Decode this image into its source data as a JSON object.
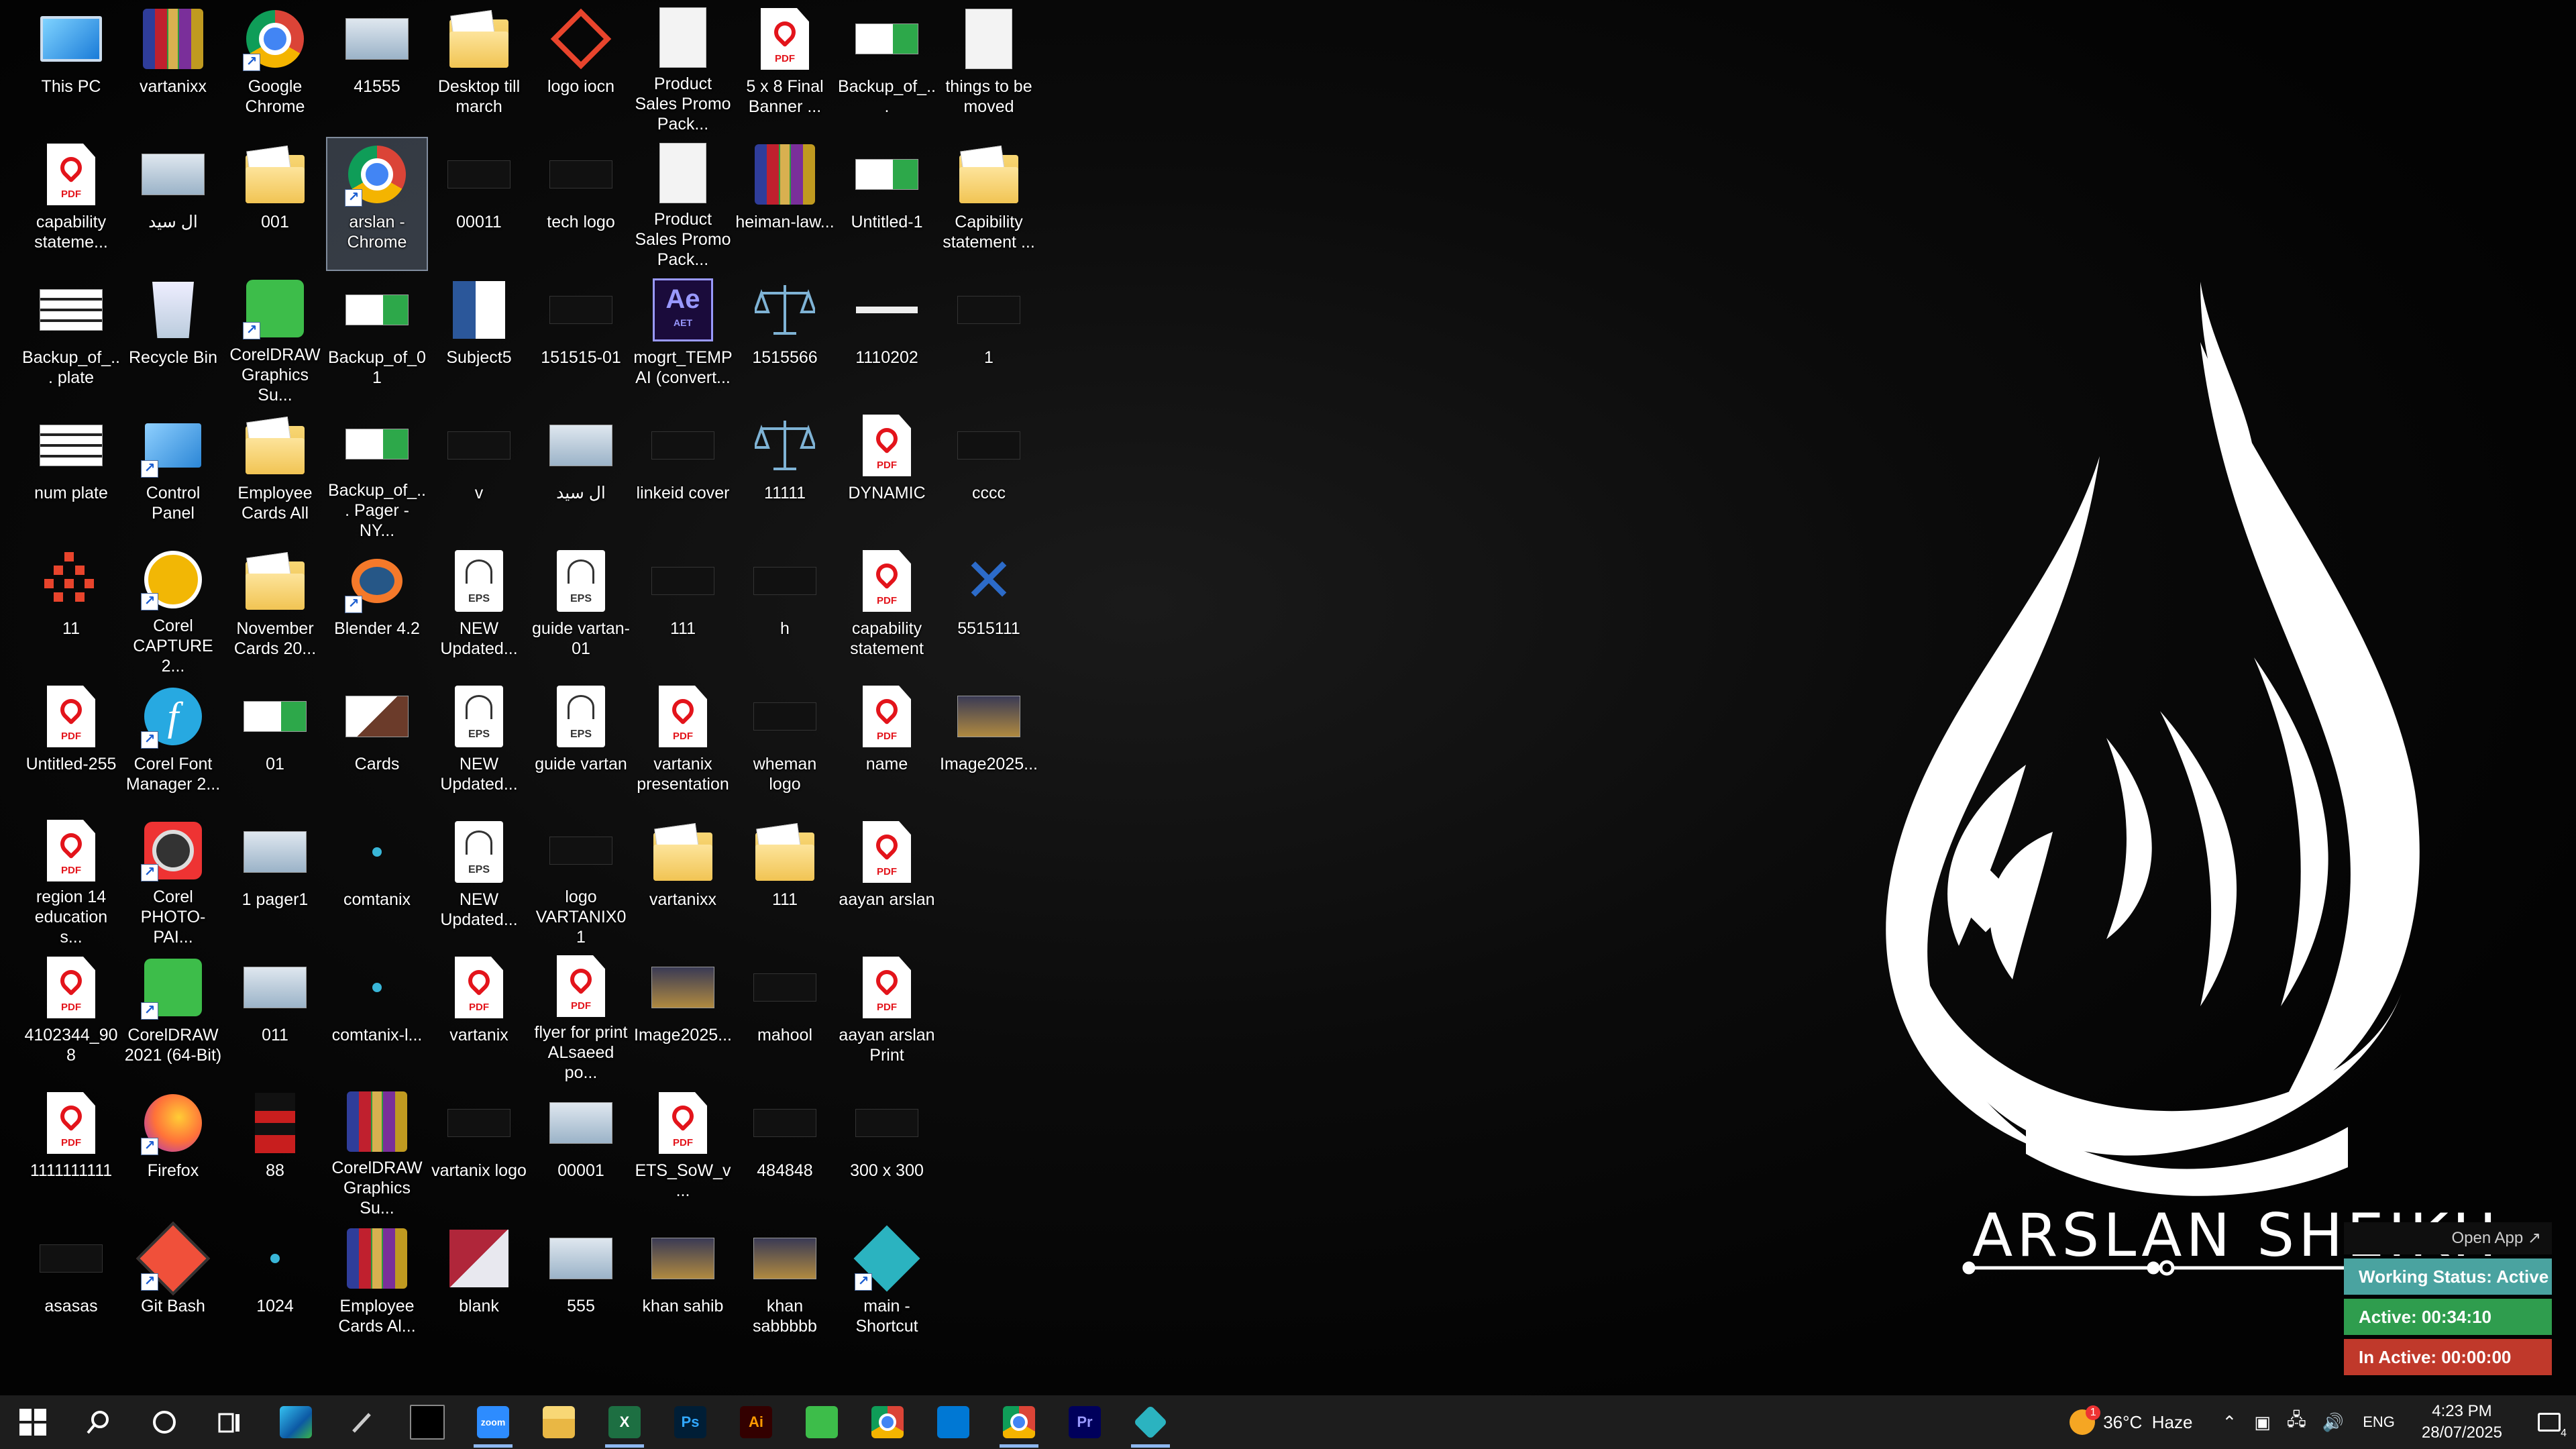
{
  "desktop": {
    "icons": [
      [
        "This PC",
        "vartanixx",
        "Google Chrome",
        "41555",
        "Desktop till march",
        "logo iocn",
        "Product Sales Promo Pack...",
        "5 x 8 Final Banner ...",
        "Backup_of_...",
        "things to be moved"
      ],
      [
        "capability stateme...",
        "ال سيد",
        "001",
        "arslan - Chrome",
        "00011",
        "tech logo",
        "Product Sales Promo Pack...",
        "heiman-law...",
        "Untitled-1",
        "Capibility statement ..."
      ],
      [
        "Backup_of_... plate",
        "Recycle Bin",
        "CorelDRAW Graphics Su...",
        "Backup_of_01",
        "Subject5",
        "151515-01",
        "mogrt_TEMP AI (convert...",
        "1515566",
        "1110202",
        "1"
      ],
      [
        "num plate",
        "Control Panel",
        "Employee Cards All",
        "Backup_of_... Pager - NY...",
        "v",
        "ال سيد",
        "linkeid cover",
        "11111",
        "DYNAMIC",
        "cccc"
      ],
      [
        "11",
        "Corel CAPTURE 2...",
        "November Cards 20...",
        "Blender 4.2",
        "NEW Updated...",
        "guide vartan-01",
        "111",
        "h",
        "capability statement",
        "5515111"
      ],
      [
        "Untitled-255",
        "Corel Font Manager 2...",
        "01",
        "Cards",
        "NEW Updated...",
        "guide vartan",
        "vartanix presentation",
        "wheman logo",
        "name",
        "Image2025..."
      ],
      [
        "region 14 education s...",
        "Corel PHOTO-PAI...",
        "1 pager1",
        "comtanix",
        "NEW Updated...",
        "logo VARTANIX01",
        "vartanixx",
        "111",
        "aayan arslan",
        ""
      ],
      [
        "4102344_908",
        "CorelDRAW 2021 (64-Bit)",
        "011",
        "comtanix-l...",
        "vartanix",
        "flyer for print ALsaeed po...",
        "Image2025...",
        "mahool",
        "aayan arslan Print",
        ""
      ],
      [
        "1111111111",
        "Firefox",
        "88",
        "CorelDRAW Graphics Su...",
        "vartanix logo",
        "00001",
        "ETS_SoW_v...",
        "484848",
        "300 x 300",
        ""
      ],
      [
        "asasas",
        "Git Bash",
        "1024",
        "Employee Cards Al...",
        "blank",
        "555",
        "khan sahib",
        "khan sabbbbb",
        "main - Shortcut",
        ""
      ]
    ],
    "pdf_tag": "PDF",
    "eps_tag": "EPS",
    "ae_tag": "Ae",
    "aet_tag": "AET"
  },
  "wallpaper": {
    "name": "ARSLAN SHEIKH"
  },
  "tracker": {
    "open_app": "Open App ↗",
    "status": "Working Status: Active",
    "active": "Active: 00:34:10",
    "inactive": "In Active: 00:00:00",
    "colors": {
      "status": "#4aa3a0",
      "active": "#2f9d4e",
      "inactive": "#c0392b"
    }
  },
  "taskbar": {
    "apps": [
      {
        "name": "start-icon"
      },
      {
        "name": "search-icon"
      },
      {
        "name": "cortana-icon"
      },
      {
        "name": "task-view-icon"
      },
      {
        "name": "edge-icon"
      },
      {
        "name": "pen-icon"
      },
      {
        "name": "terminal-icon"
      },
      {
        "name": "zoom-icon",
        "label": "zoom"
      },
      {
        "name": "file-explorer-icon"
      },
      {
        "name": "excel-icon",
        "label": "X"
      },
      {
        "name": "photoshop-icon",
        "label": "Ps"
      },
      {
        "name": "illustrator-icon",
        "label": "Ai"
      },
      {
        "name": "coreldraw-icon"
      },
      {
        "name": "chrome-icon"
      },
      {
        "name": "vscode-icon"
      },
      {
        "name": "chrome-profile-icon"
      },
      {
        "name": "premiere-icon",
        "label": "Pr"
      },
      {
        "name": "tracker-app-icon"
      }
    ],
    "weather_badge": "1",
    "weather": "36°C  Haze",
    "language": "ENG",
    "time": "4:23 PM",
    "date": "28/07/2025",
    "notifications": "4"
  }
}
